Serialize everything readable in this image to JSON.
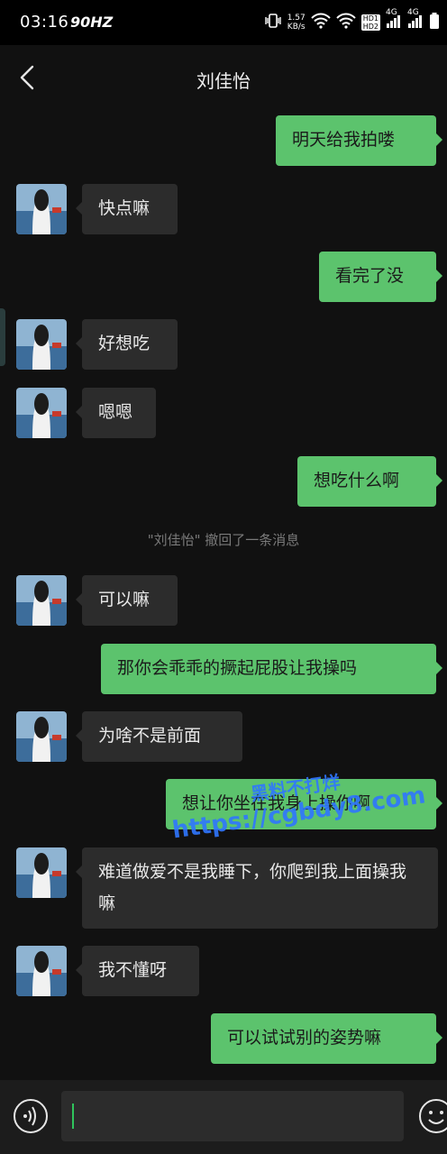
{
  "status_bar": {
    "time": "03:16",
    "refresh_rate": "90HZ",
    "net_speed_value": "1.57",
    "net_speed_unit": "KB/s",
    "hd1": "HD1",
    "hd2": "HD2",
    "network_4g_a": "4G",
    "network_4g_b": "4G"
  },
  "header": {
    "title": "刘佳怡"
  },
  "messages": [
    {
      "side": "me",
      "text": "明天给我拍喽"
    },
    {
      "side": "them",
      "text": "快点嘛"
    },
    {
      "side": "me",
      "text": "看完了没"
    },
    {
      "side": "them",
      "text": "好想吃"
    },
    {
      "side": "them",
      "text": "嗯嗯"
    },
    {
      "side": "me",
      "text": "想吃什么啊"
    },
    {
      "side": "them",
      "text": "可以嘛"
    },
    {
      "side": "me",
      "text": "那你会乖乖的撅起屁股让我操吗"
    },
    {
      "side": "them",
      "text": "为啥不是前面"
    },
    {
      "side": "me",
      "text": "想让你坐在我身上操你啊"
    },
    {
      "side": "them",
      "text": "难道做爱不是我睡下，你爬到我上面操我嘛"
    },
    {
      "side": "them",
      "text": "我不懂呀"
    },
    {
      "side": "me",
      "text": "可以试试别的姿势嘛"
    }
  ],
  "system_notice": "\"刘佳怡\" 撤回了一条消息",
  "watermark": {
    "line1": "黑料不打烊",
    "line2": "https://cgbdy8.com"
  },
  "input": {
    "value": ""
  },
  "icons": {
    "back": "chevron-left-icon",
    "voice": "voice-icon",
    "emoji": "emoji-icon",
    "avatar": "avatar-photo"
  },
  "colors": {
    "me_bubble": "#5cc36d",
    "them_bubble": "#2c2c2c",
    "background": "#111111",
    "caret": "#2fc45c"
  }
}
